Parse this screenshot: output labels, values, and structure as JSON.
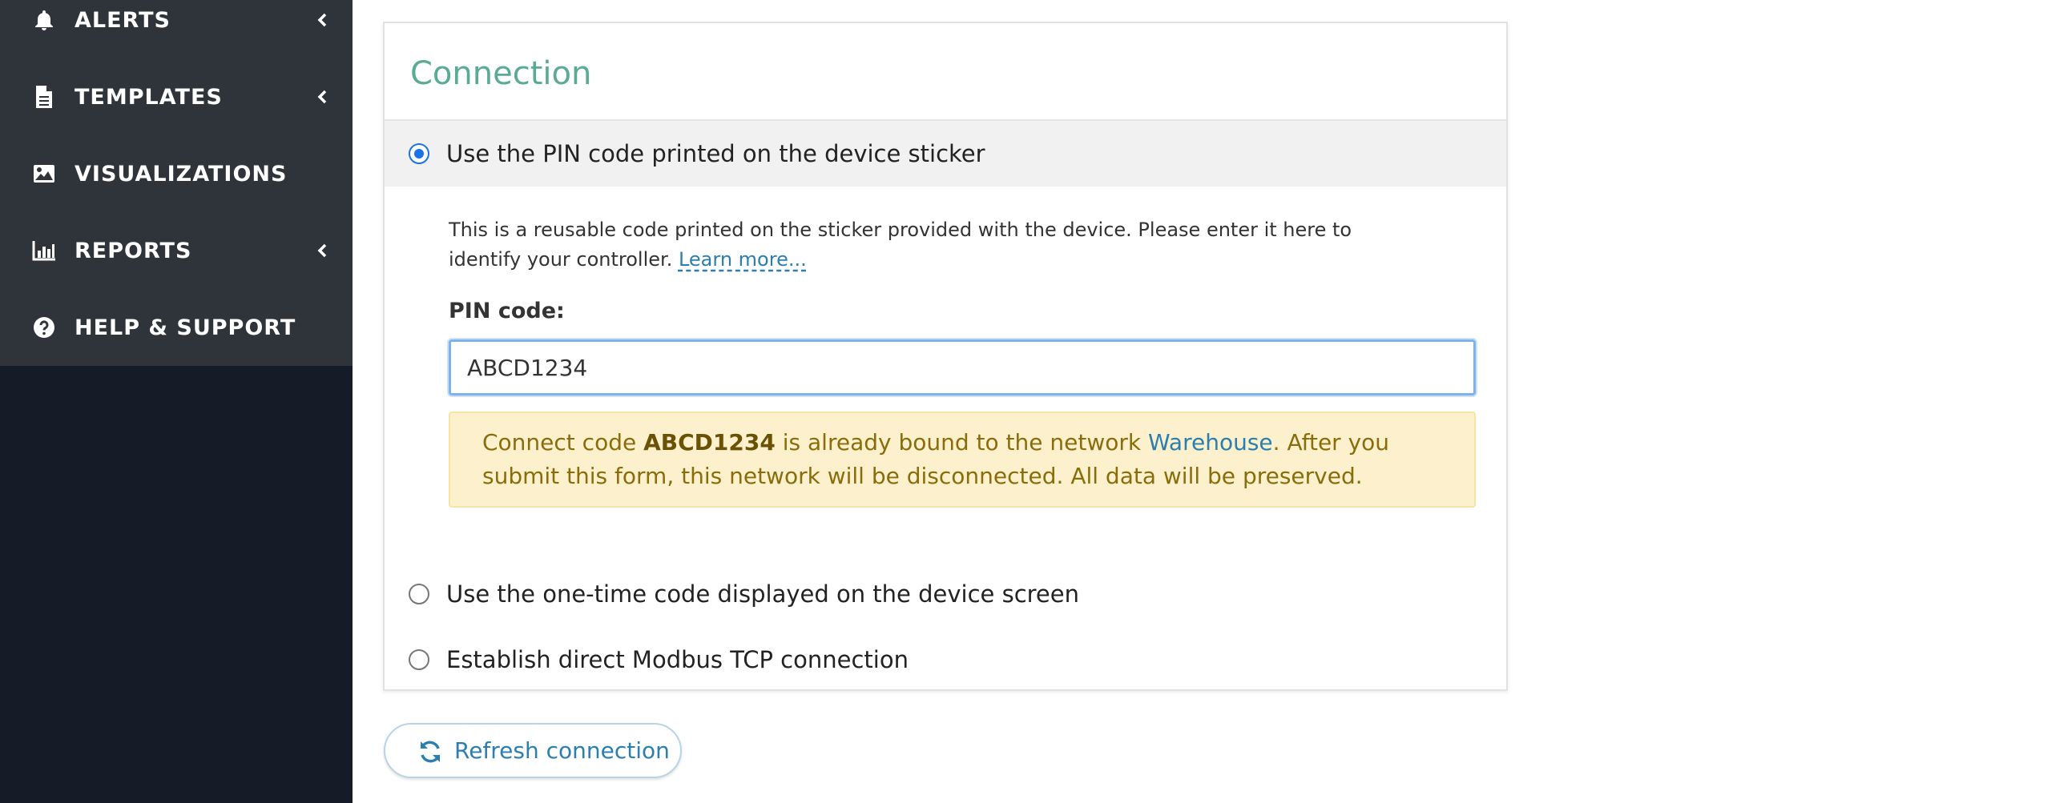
{
  "sidebar": {
    "items": [
      {
        "label": "ALERTS",
        "icon": "bell-icon",
        "has_submenu": true
      },
      {
        "label": "TEMPLATES",
        "icon": "file-icon",
        "has_submenu": true
      },
      {
        "label": "VISUALIZATIONS",
        "icon": "image-icon",
        "has_submenu": false
      },
      {
        "label": "REPORTS",
        "icon": "bar-chart-icon",
        "has_submenu": true
      },
      {
        "label": "HELP & SUPPORT",
        "icon": "question-circle-icon",
        "has_submenu": false
      }
    ]
  },
  "connection": {
    "title": "Connection",
    "options": [
      {
        "label": "Use the PIN code printed on the device sticker",
        "selected": true
      },
      {
        "label": "Use the one-time code displayed on the device screen",
        "selected": false
      },
      {
        "label": "Establish direct Modbus TCP connection",
        "selected": false
      }
    ],
    "description": "This is a reusable code printed on the sticker provided with the device. Please enter it here to identify your controller.",
    "learn_more": "Learn more...",
    "pin_label": "PIN code:",
    "pin_value": "ABCD1234",
    "warning": {
      "prefix": "Connect code ",
      "code": "ABCD1234",
      "middle": " is already bound to the network ",
      "network": "Warehouse",
      "suffix": ". After you submit this form, this network will be disconnected. All data will be preserved."
    }
  },
  "refresh_button": {
    "label": "Refresh connection",
    "icon": "refresh-icon"
  },
  "colors": {
    "sidebar_menu_bg": "#2f333a",
    "sidebar_bg": "#161c27",
    "title_color": "#5aab93",
    "link_color": "#2b7fb0",
    "radio_accent": "#1a73e8",
    "warning_bg": "#fcf1cc",
    "warning_text": "#8a6d0b"
  }
}
